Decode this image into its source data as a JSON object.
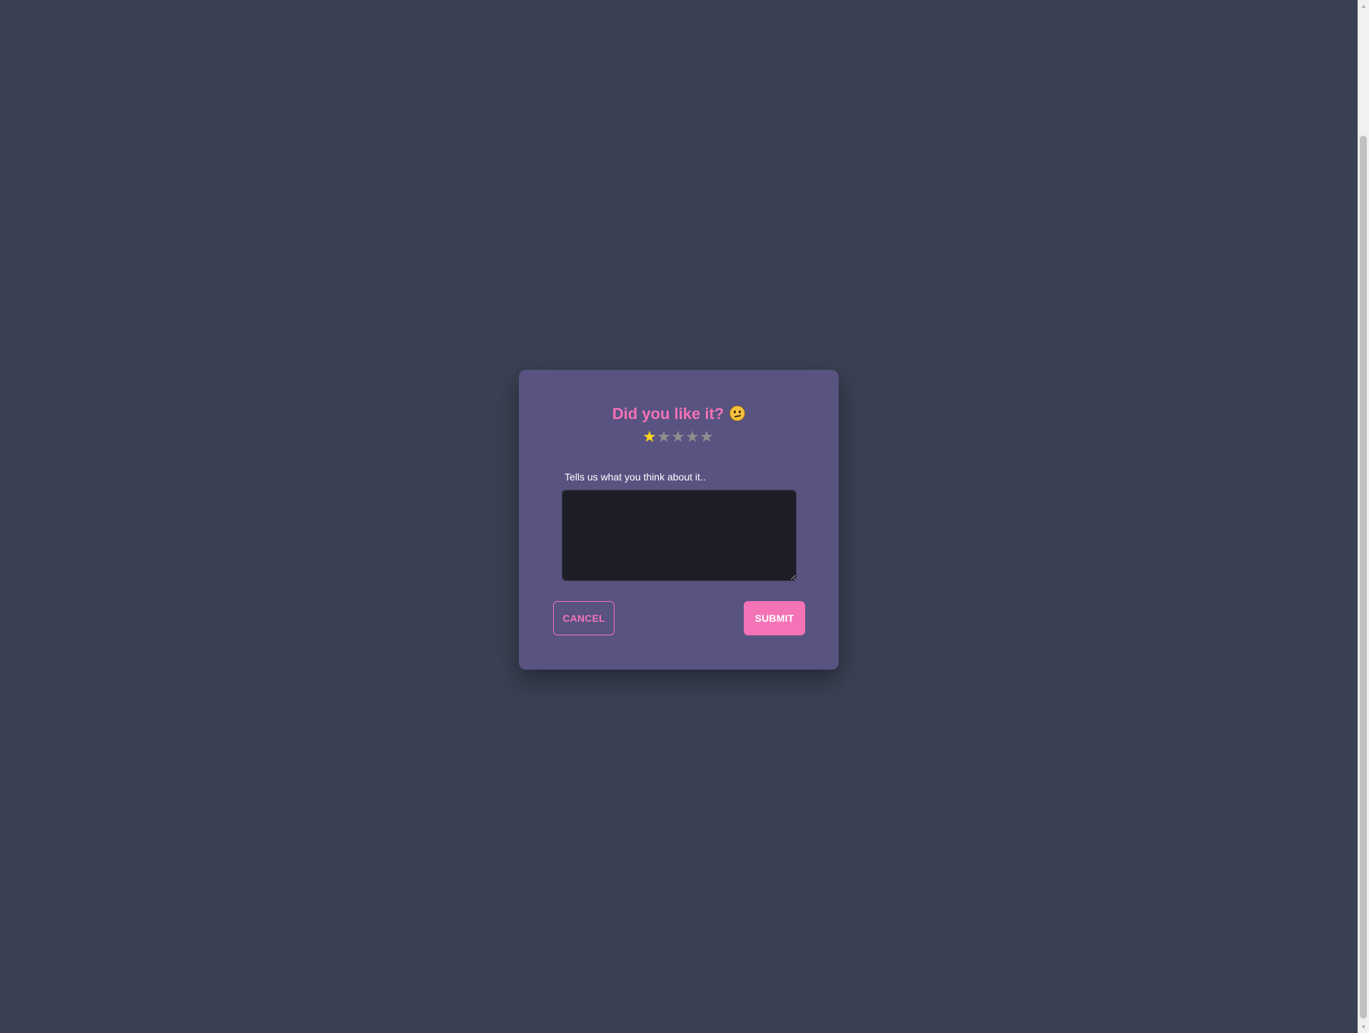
{
  "modal": {
    "title": "Did you like it?",
    "title_emoji": "thinking-face-emoji",
    "rating": {
      "value": 1,
      "max": 5,
      "star_glyph": "★",
      "active_color": "#fbd61f",
      "inactive_color": "#8f8f8f"
    },
    "prompt_label": "Tells us what you think about it..",
    "feedback": {
      "value": "",
      "placeholder": ""
    },
    "cancel_label": "CANCEL",
    "submit_label": "SUBMIT"
  },
  "colors": {
    "page_background": "#394152",
    "modal_background": "#585381",
    "accent": "#f472b6",
    "textarea_background": "#1e1e28"
  }
}
